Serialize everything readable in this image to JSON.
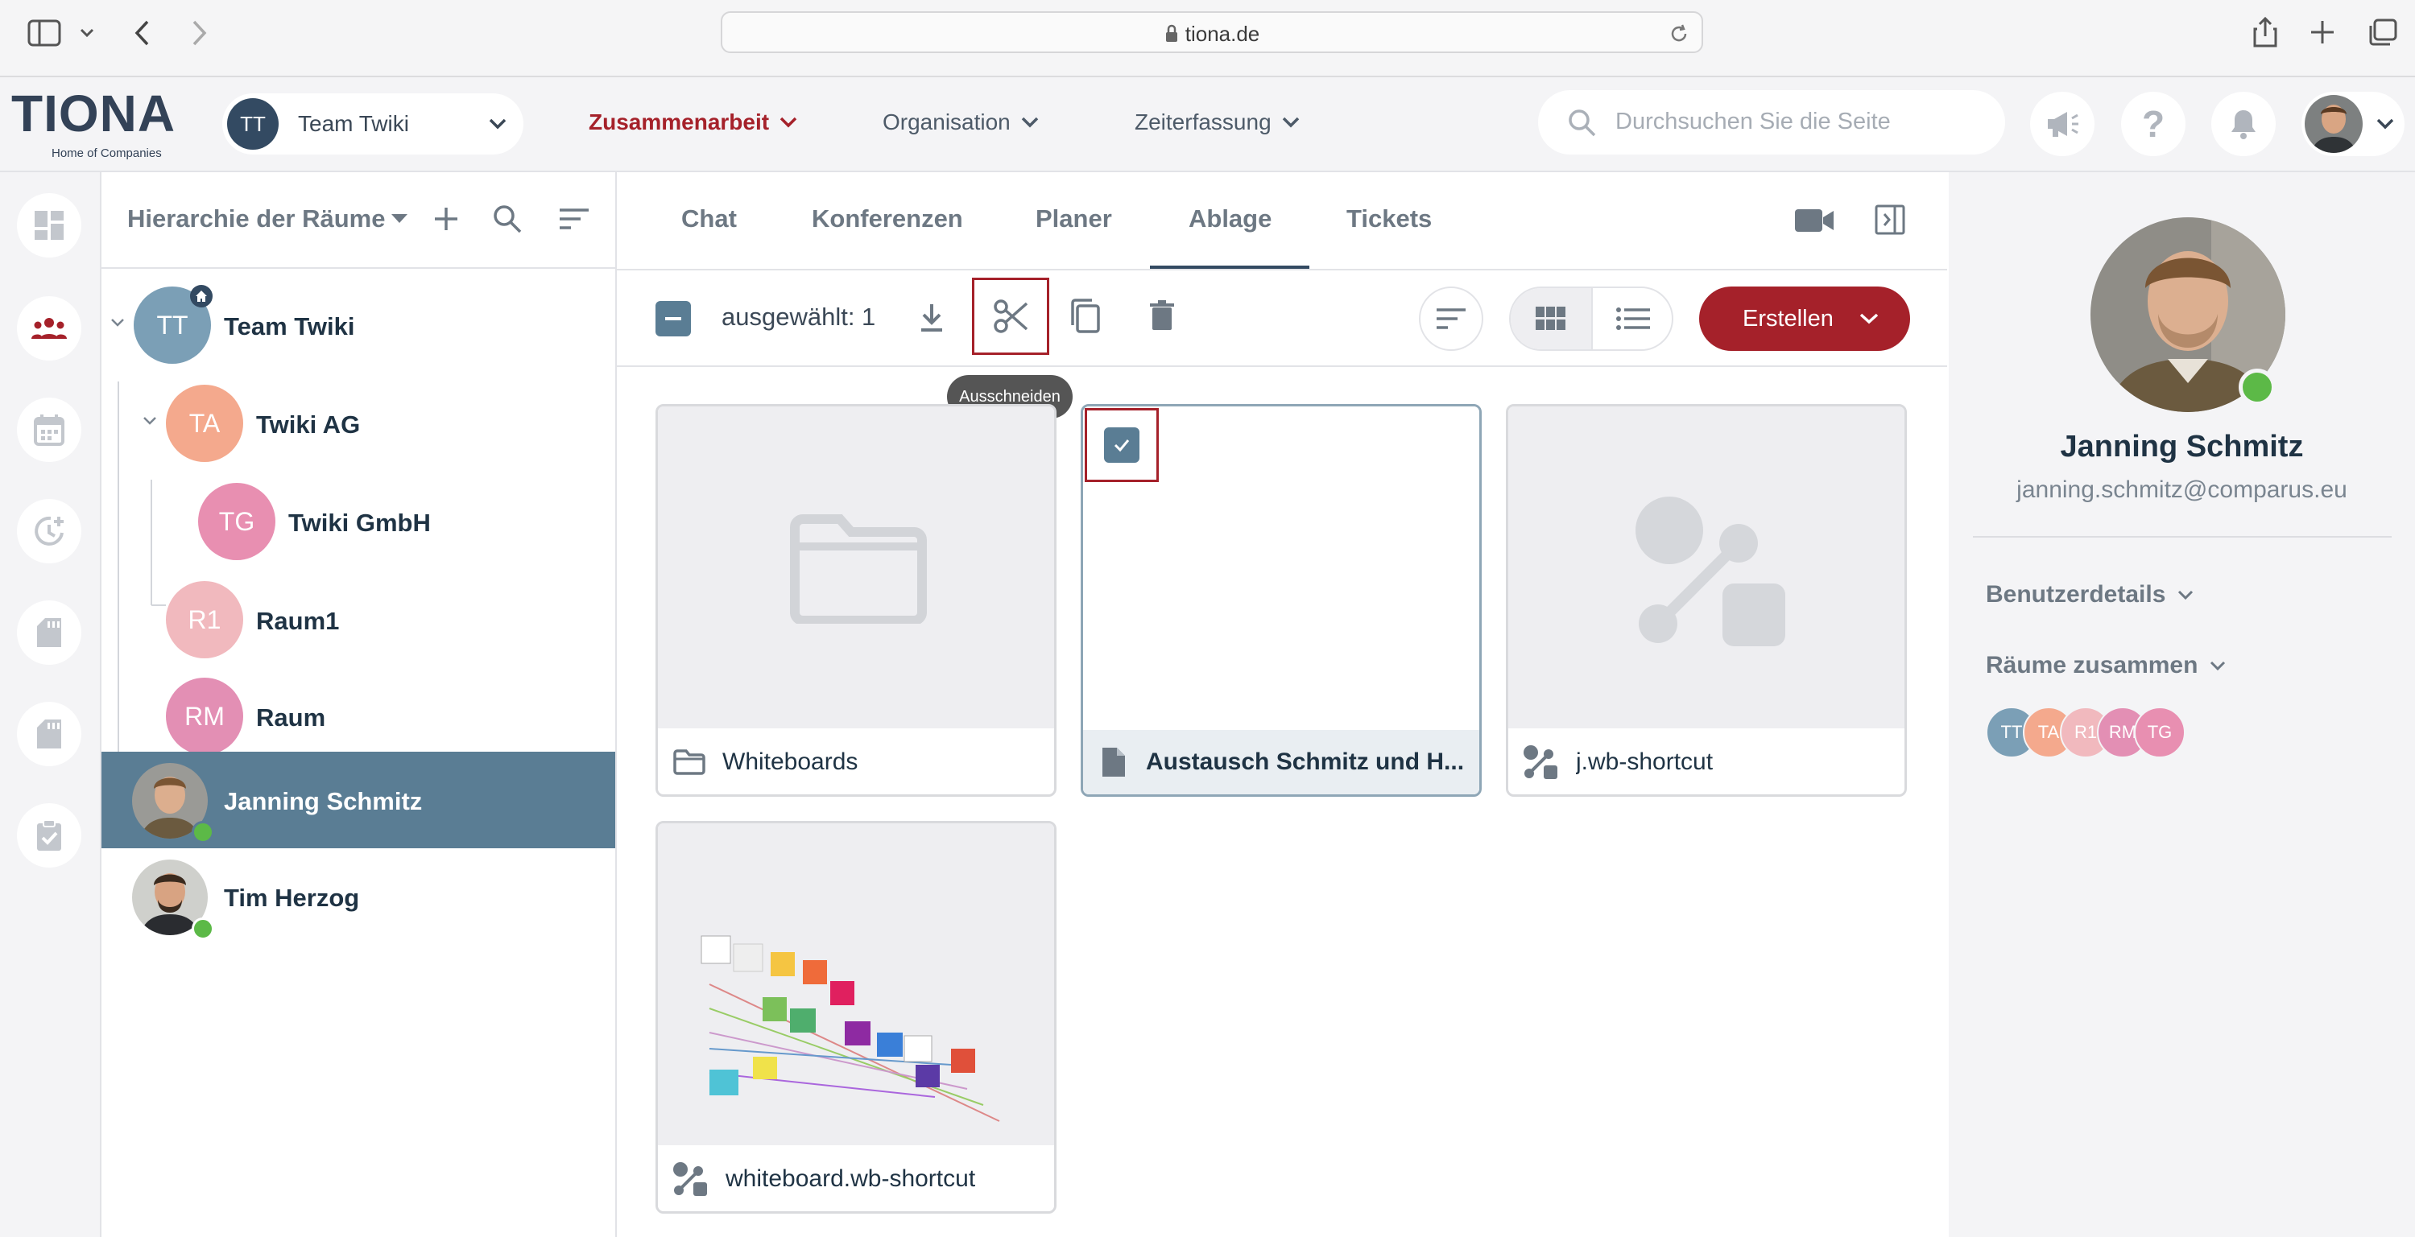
{
  "browser": {
    "url": "tiona.de"
  },
  "header": {
    "logo": "TIONA",
    "logo_sub": "Home of Companies",
    "team_avatar": "TT",
    "team_name": "Team Twiki",
    "nav": [
      {
        "label": "Zusammenarbeit",
        "active": true
      },
      {
        "label": "Organisation",
        "active": false
      },
      {
        "label": "Zeiterfassung",
        "active": false
      }
    ],
    "search_placeholder": "Durchsuchen Sie die Seite"
  },
  "tree": {
    "title": "Hierarchie der Räume",
    "items": [
      {
        "initials": "TT",
        "label": "Team Twiki",
        "color": "#7b9fb6"
      },
      {
        "initials": "TA",
        "label": "Twiki AG",
        "color": "#f4a98d"
      },
      {
        "initials": "TG",
        "label": "Twiki GmbH",
        "color": "#e88fb1"
      },
      {
        "initials": "R1",
        "label": "Raum1",
        "color": "#f1b9be"
      },
      {
        "initials": "RM",
        "label": "Raum",
        "color": "#e38fb4"
      }
    ],
    "users": [
      {
        "label": "Janning Schmitz",
        "selected": true
      },
      {
        "label": "Tim Herzog",
        "selected": false
      }
    ]
  },
  "tabs": [
    "Chat",
    "Konferenzen",
    "Planer",
    "Ablage",
    "Tickets"
  ],
  "active_tab": "Ablage",
  "toolbar": {
    "selected_label": "ausgewählt: 1",
    "tooltip": "Ausschneiden",
    "create_label": "Erstellen"
  },
  "files": [
    {
      "name": "Whiteboards",
      "type": "folder"
    },
    {
      "name": "Austausch Schmitz und H...",
      "type": "document",
      "selected": true
    },
    {
      "name": "j.wb-shortcut",
      "type": "shortcut"
    },
    {
      "name": "whiteboard.wb-shortcut",
      "type": "shortcut"
    }
  ],
  "profile": {
    "name": "Janning Schmitz",
    "email": "janning.schmitz@comparus.eu",
    "section_user": "Benutzerdetails",
    "section_rooms": "Räume zusammen",
    "rooms": [
      {
        "initials": "TT",
        "color": "#7b9fb6"
      },
      {
        "initials": "TA",
        "color": "#f4a98d"
      },
      {
        "initials": "R1",
        "color": "#f1b9be"
      },
      {
        "initials": "RM",
        "color": "#e38fb4"
      },
      {
        "initials": "TG",
        "color": "#e88fb1"
      }
    ]
  },
  "colors": {
    "accent": "#a5212a",
    "selected_row": "#5a7d94",
    "online": "#5cb947"
  }
}
